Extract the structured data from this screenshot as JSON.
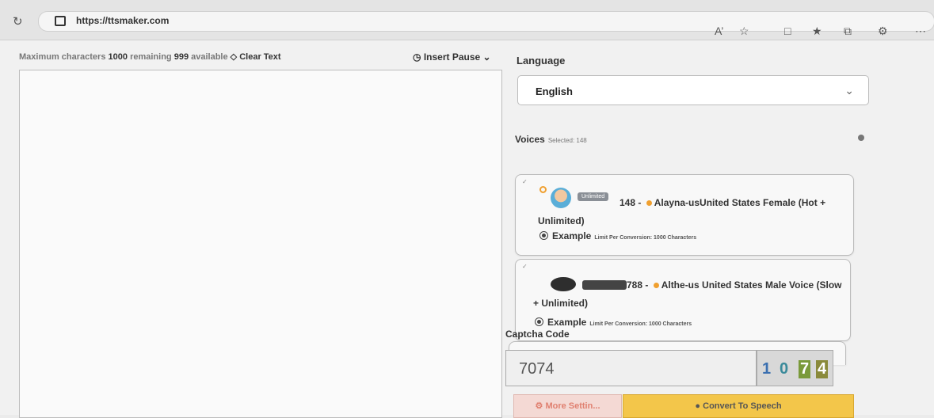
{
  "browser": {
    "url": "https://ttsmaker.com",
    "toolbar_icons": [
      "read-aloud-icon",
      "favorite-star-icon",
      "split-screen-icon",
      "favorites-icon",
      "collections-icon",
      "extensions-icon",
      "more-icon"
    ]
  },
  "editor": {
    "max_chars_prefix": "Maximum characters",
    "max_chars_value": "1000",
    "remaining_label": "remaining",
    "remaining_value": "999",
    "available_label": "available",
    "clear_text_label": "Clear Text",
    "insert_pause_label": "Insert Pause",
    "text_value": ""
  },
  "language": {
    "label": "Language",
    "selected": "English"
  },
  "voices": {
    "label": "Voices",
    "selected_text": "Selected: 148",
    "items": [
      {
        "badge": "Unlimited",
        "title": "148 - Alayna-usUnited States Female (Hot + Unlimited)",
        "example_label": "Example",
        "limit_text": "Limit Per Conversion: 1000 Characters"
      },
      {
        "title": "788 - Althe-us United States Male Voice (Slow + Unlimited)",
        "example_label": "Example",
        "limit_text": "Limit Per Conversion: 1000 Characters"
      }
    ]
  },
  "captcha": {
    "label": "Captcha Code",
    "value": "7074",
    "image_chars": [
      "1",
      "0",
      "7",
      "4"
    ]
  },
  "actions": {
    "more_settings_label": "More Settin...",
    "convert_label": "Convert To Speech"
  },
  "colors": {
    "accent_orange": "#f0a030",
    "convert_button": "#f3c64a",
    "more_settings_button": "#f4d9d4"
  }
}
